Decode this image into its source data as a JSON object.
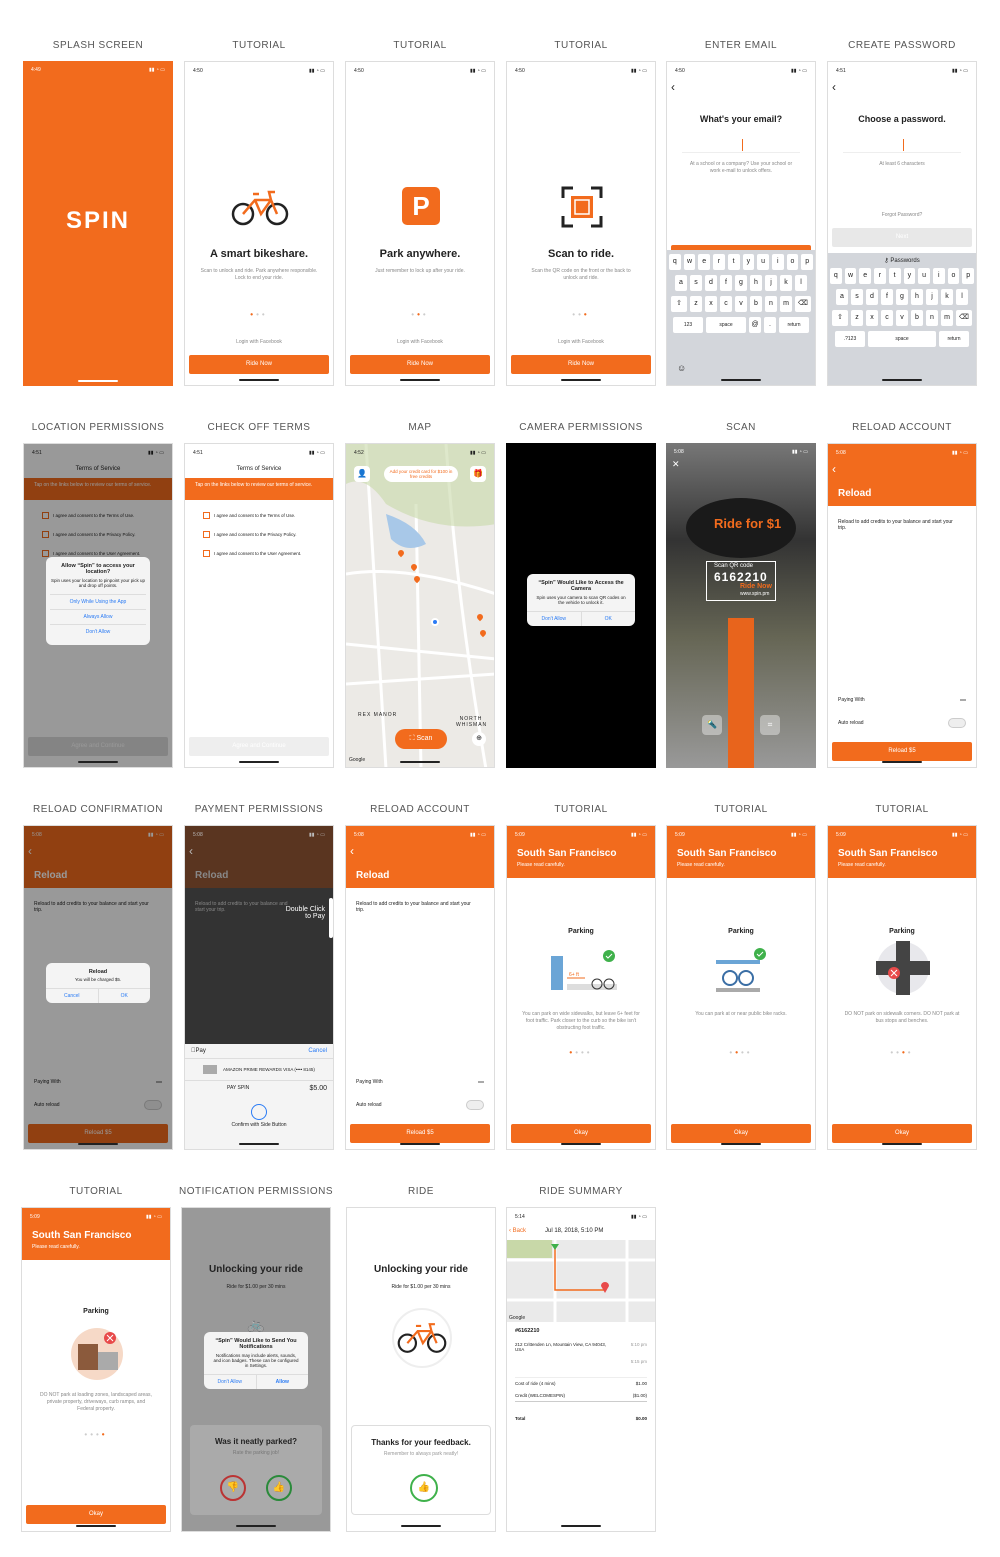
{
  "screens": [
    {
      "caption": "SPLASH SCREEN",
      "time": "4:49",
      "logo": "SPIN"
    },
    {
      "caption": "TUTORIAL",
      "time": "4:50",
      "title": "A smart bikeshare.",
      "body": "Scan to unlock and ride. Park anywhere responsible. Lock to end your ride.",
      "fb": "Login with Facebook",
      "cta": "Ride Now"
    },
    {
      "caption": "TUTORIAL",
      "time": "4:50",
      "title": "Park anywhere.",
      "body": "Just remember to lock up after your ride.",
      "fb": "Login with Facebook",
      "cta": "Ride Now"
    },
    {
      "caption": "TUTORIAL",
      "time": "4:50",
      "title": "Scan to ride.",
      "body": "Scan the QR code on the front or the back to unlock and ride.",
      "fb": "Login with Facebook",
      "cta": "Ride Now"
    },
    {
      "caption": "ENTER EMAIL",
      "time": "4:50",
      "title": "What's your email?",
      "hint": "At a school or a company? Use your school or work e-mail to unlock offers.",
      "cta": "Next"
    },
    {
      "caption": "CREATE PASSWORD",
      "time": "4:51",
      "title": "Choose a password.",
      "hint": "At least 6 characters",
      "forgot": "Forgot Password?",
      "cta": "Next",
      "passwords": "Passwords"
    },
    {
      "caption": "LOCATION PERMISSIONS",
      "time": "4:51",
      "title": "Terms of Service",
      "banner": "Tap on the links below to review our terms of service.",
      "t1": "I agree and consent to the Terms of Use.",
      "t2": "I agree and consent to the Privacy Policy.",
      "t3": "I agree and consent to the User Agreement.",
      "alert_title": "Allow “Spin” to access your location?",
      "alert_body": "Spin uses your location to pinpoint your pick up and drop off points.",
      "o1": "Only While Using the App",
      "o2": "Always Allow",
      "o3": "Don't Allow",
      "cta": "Agree and Continue"
    },
    {
      "caption": "CHECK OFF TERMS",
      "time": "4:51",
      "title": "Terms of Service",
      "banner": "Tap on the links below to review our terms of service.",
      "t1": "I agree and consent to the Terms of Use.",
      "t2": "I agree and consent to the Privacy Policy.",
      "t3": "I agree and consent to the User Agreement.",
      "cta": "Agree and Continue"
    },
    {
      "caption": "MAP",
      "time": "4:52",
      "promo": "Add your credit card for $100 in free credits",
      "scan": "Scan",
      "rex": "REX MANOR",
      "north": "NORTH WHISMAN",
      "google": "Google"
    },
    {
      "caption": "CAMERA PERMISSIONS",
      "alert_title": "“Spin” Would Like to Access the Camera",
      "alert_body": "Spin uses your camera to scan QR codes on the vehicle to unlock it.",
      "deny": "Don't Allow",
      "ok": "OK"
    },
    {
      "caption": "SCAN",
      "time": "5:08",
      "ride": "Ride for $1",
      "code_label": "Scan QR code",
      "code": "6162210",
      "ridenow": "Ride Now",
      "url": "www.spin.pm"
    },
    {
      "caption": "RELOAD ACCOUNT",
      "time": "5:08",
      "title": "Reload",
      "body": "Reload to add credits to your balance and start your trip.",
      "paying": "Paying With",
      "auto": "Auto reload",
      "cta": "Reload $5"
    },
    {
      "caption": "RELOAD CONFIRMATION",
      "time": "5:08",
      "title": "Reload",
      "body": "Reload to add credits to your balance and start your trip.",
      "alert_title": "Reload",
      "alert_body": "You will be charged $5.",
      "cancel": "Cancel",
      "ok": "OK",
      "paying": "Paying With",
      "auto": "Auto reload",
      "cta": "Reload $5"
    },
    {
      "caption": "PAYMENT PERMISSIONS",
      "time": "5:08",
      "title": "Reload",
      "body": "Reload to add credits to your balance and start your trip.",
      "dbl": "Double Click to Pay",
      "pay": "Pay",
      "cancel": "Cancel",
      "card": "AMAZON PRIME REWARDS VISA (•••• 8145)",
      "payee": "PAY SPIN",
      "amount": "$5.00",
      "confirm": "Confirm with Side Button"
    },
    {
      "caption": "RELOAD ACCOUNT",
      "time": "5:08",
      "title": "Reload",
      "body": "Reload to add credits to your balance and start your trip.",
      "paying": "Paying With",
      "auto": "Auto reload",
      "cta": "Reload $5"
    },
    {
      "caption": "TUTORIAL",
      "time": "5:09",
      "city": "South San Francisco",
      "sub": "Please read carefully.",
      "title": "Parking",
      "body": "You can park on wide sidewalks, but leave 6+ feet for foot traffic. Park closer to the curb so the bike isn't obstructing foot traffic.",
      "cta": "Okay"
    },
    {
      "caption": "TUTORIAL",
      "time": "5:09",
      "city": "South San Francisco",
      "sub": "Please read carefully.",
      "title": "Parking",
      "body": "You can park at or near public bike racks.",
      "cta": "Okay"
    },
    {
      "caption": "TUTORIAL",
      "time": "5:09",
      "city": "South San Francisco",
      "sub": "Please read carefully.",
      "title": "Parking",
      "body": "DO NOT park on sidewalk corners. DO NOT park at bus stops and benches.",
      "cta": "Okay"
    },
    {
      "caption": "TUTORIAL",
      "time": "5:09",
      "city": "South San Francisco",
      "sub": "Please read carefully.",
      "title": "Parking",
      "body": "DO NOT park at loading zones, landscaped areas, private property, driveways, curb ramps, and Federal property.",
      "cta": "Okay"
    },
    {
      "caption": "NOTIFICATION PERMISSIONS",
      "title": "Unlocking your ride",
      "rate": "Ride for $1.00 per 30 mins",
      "alert_title": "“Spin” Would Like to Send You Notifications",
      "alert_body": "Notifications may include alerts, sounds, and icon badges. These can be configured in Settings.",
      "deny": "Don't Allow",
      "allow": "Allow",
      "q": "Was it neatly parked?",
      "qsub": "Rate the parking job!"
    },
    {
      "caption": "RIDE",
      "title": "Unlocking your ride",
      "rate": "Ride for $1.00 per 30 mins",
      "thanks": "Thanks for your feedback.",
      "thanks_sub": "Remember to always park neatly!"
    },
    {
      "caption": "RIDE SUMMARY",
      "time": "5:14",
      "back": "Back",
      "date": "Jul 18, 2018, 5:10 PM",
      "id": "#6162210",
      "addr": "212 Crittenden Ln, Mountain View, CA 94043, USA",
      "t1": "5:10 pm",
      "t2": "5:15 pm",
      "cost_l": "Cost of ride (4 mins)",
      "cost": "$1.00",
      "credit_l": "Credit (WELCOMESPIN)",
      "credit": "($1.00)",
      "total_l": "Total",
      "total": "$0.00",
      "google": "Google"
    }
  ],
  "keyboard": {
    "r1": [
      "q",
      "w",
      "e",
      "r",
      "t",
      "y",
      "u",
      "i",
      "o",
      "p"
    ],
    "r2": [
      "a",
      "s",
      "d",
      "f",
      "g",
      "h",
      "j",
      "k",
      "l"
    ],
    "r3": [
      "z",
      "x",
      "c",
      "v",
      "b",
      "n",
      "m"
    ],
    "n123": "123",
    "n123b": ".?123",
    "space": "space",
    "ret": "return",
    "at": "@",
    "dot": "."
  },
  "colors": {
    "accent": "#f26b1d",
    "link": "#2a7bf5"
  }
}
